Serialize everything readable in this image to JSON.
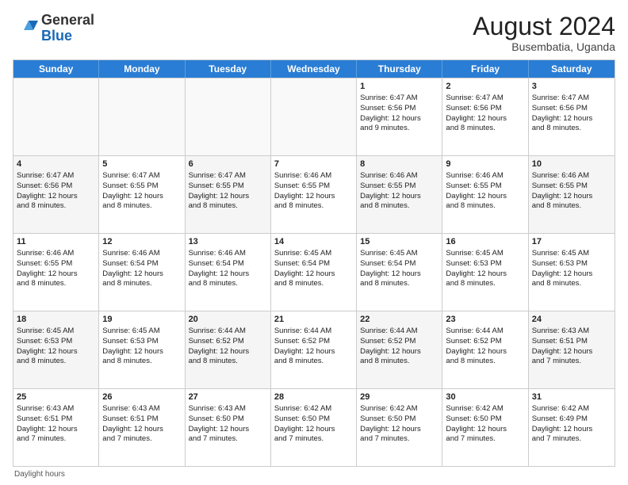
{
  "header": {
    "logo_general": "General",
    "logo_blue": "Blue",
    "month_year": "August 2024",
    "location": "Busembatia, Uganda"
  },
  "weekdays": [
    "Sunday",
    "Monday",
    "Tuesday",
    "Wednesday",
    "Thursday",
    "Friday",
    "Saturday"
  ],
  "footer_text": "Daylight hours",
  "rows": [
    [
      {
        "day": "",
        "info": "",
        "empty": true
      },
      {
        "day": "",
        "info": "",
        "empty": true
      },
      {
        "day": "",
        "info": "",
        "empty": true
      },
      {
        "day": "",
        "info": "",
        "empty": true
      },
      {
        "day": "1",
        "info": "Sunrise: 6:47 AM\nSunset: 6:56 PM\nDaylight: 12 hours\nand 9 minutes.",
        "empty": false
      },
      {
        "day": "2",
        "info": "Sunrise: 6:47 AM\nSunset: 6:56 PM\nDaylight: 12 hours\nand 8 minutes.",
        "empty": false
      },
      {
        "day": "3",
        "info": "Sunrise: 6:47 AM\nSunset: 6:56 PM\nDaylight: 12 hours\nand 8 minutes.",
        "empty": false
      }
    ],
    [
      {
        "day": "4",
        "info": "Sunrise: 6:47 AM\nSunset: 6:56 PM\nDaylight: 12 hours\nand 8 minutes.",
        "empty": false,
        "alt": true
      },
      {
        "day": "5",
        "info": "Sunrise: 6:47 AM\nSunset: 6:55 PM\nDaylight: 12 hours\nand 8 minutes.",
        "empty": false,
        "alt": false
      },
      {
        "day": "6",
        "info": "Sunrise: 6:47 AM\nSunset: 6:55 PM\nDaylight: 12 hours\nand 8 minutes.",
        "empty": false,
        "alt": true
      },
      {
        "day": "7",
        "info": "Sunrise: 6:46 AM\nSunset: 6:55 PM\nDaylight: 12 hours\nand 8 minutes.",
        "empty": false,
        "alt": false
      },
      {
        "day": "8",
        "info": "Sunrise: 6:46 AM\nSunset: 6:55 PM\nDaylight: 12 hours\nand 8 minutes.",
        "empty": false,
        "alt": true
      },
      {
        "day": "9",
        "info": "Sunrise: 6:46 AM\nSunset: 6:55 PM\nDaylight: 12 hours\nand 8 minutes.",
        "empty": false,
        "alt": false
      },
      {
        "day": "10",
        "info": "Sunrise: 6:46 AM\nSunset: 6:55 PM\nDaylight: 12 hours\nand 8 minutes.",
        "empty": false,
        "alt": true
      }
    ],
    [
      {
        "day": "11",
        "info": "Sunrise: 6:46 AM\nSunset: 6:55 PM\nDaylight: 12 hours\nand 8 minutes.",
        "empty": false
      },
      {
        "day": "12",
        "info": "Sunrise: 6:46 AM\nSunset: 6:54 PM\nDaylight: 12 hours\nand 8 minutes.",
        "empty": false
      },
      {
        "day": "13",
        "info": "Sunrise: 6:46 AM\nSunset: 6:54 PM\nDaylight: 12 hours\nand 8 minutes.",
        "empty": false
      },
      {
        "day": "14",
        "info": "Sunrise: 6:45 AM\nSunset: 6:54 PM\nDaylight: 12 hours\nand 8 minutes.",
        "empty": false
      },
      {
        "day": "15",
        "info": "Sunrise: 6:45 AM\nSunset: 6:54 PM\nDaylight: 12 hours\nand 8 minutes.",
        "empty": false
      },
      {
        "day": "16",
        "info": "Sunrise: 6:45 AM\nSunset: 6:53 PM\nDaylight: 12 hours\nand 8 minutes.",
        "empty": false
      },
      {
        "day": "17",
        "info": "Sunrise: 6:45 AM\nSunset: 6:53 PM\nDaylight: 12 hours\nand 8 minutes.",
        "empty": false
      }
    ],
    [
      {
        "day": "18",
        "info": "Sunrise: 6:45 AM\nSunset: 6:53 PM\nDaylight: 12 hours\nand 8 minutes.",
        "empty": false,
        "alt": true
      },
      {
        "day": "19",
        "info": "Sunrise: 6:45 AM\nSunset: 6:53 PM\nDaylight: 12 hours\nand 8 minutes.",
        "empty": false,
        "alt": false
      },
      {
        "day": "20",
        "info": "Sunrise: 6:44 AM\nSunset: 6:52 PM\nDaylight: 12 hours\nand 8 minutes.",
        "empty": false,
        "alt": true
      },
      {
        "day": "21",
        "info": "Sunrise: 6:44 AM\nSunset: 6:52 PM\nDaylight: 12 hours\nand 8 minutes.",
        "empty": false,
        "alt": false
      },
      {
        "day": "22",
        "info": "Sunrise: 6:44 AM\nSunset: 6:52 PM\nDaylight: 12 hours\nand 8 minutes.",
        "empty": false,
        "alt": true
      },
      {
        "day": "23",
        "info": "Sunrise: 6:44 AM\nSunset: 6:52 PM\nDaylight: 12 hours\nand 8 minutes.",
        "empty": false,
        "alt": false
      },
      {
        "day": "24",
        "info": "Sunrise: 6:43 AM\nSunset: 6:51 PM\nDaylight: 12 hours\nand 7 minutes.",
        "empty": false,
        "alt": true
      }
    ],
    [
      {
        "day": "25",
        "info": "Sunrise: 6:43 AM\nSunset: 6:51 PM\nDaylight: 12 hours\nand 7 minutes.",
        "empty": false
      },
      {
        "day": "26",
        "info": "Sunrise: 6:43 AM\nSunset: 6:51 PM\nDaylight: 12 hours\nand 7 minutes.",
        "empty": false
      },
      {
        "day": "27",
        "info": "Sunrise: 6:43 AM\nSunset: 6:50 PM\nDaylight: 12 hours\nand 7 minutes.",
        "empty": false
      },
      {
        "day": "28",
        "info": "Sunrise: 6:42 AM\nSunset: 6:50 PM\nDaylight: 12 hours\nand 7 minutes.",
        "empty": false
      },
      {
        "day": "29",
        "info": "Sunrise: 6:42 AM\nSunset: 6:50 PM\nDaylight: 12 hours\nand 7 minutes.",
        "empty": false
      },
      {
        "day": "30",
        "info": "Sunrise: 6:42 AM\nSunset: 6:50 PM\nDaylight: 12 hours\nand 7 minutes.",
        "empty": false
      },
      {
        "day": "31",
        "info": "Sunrise: 6:42 AM\nSunset: 6:49 PM\nDaylight: 12 hours\nand 7 minutes.",
        "empty": false
      }
    ]
  ]
}
